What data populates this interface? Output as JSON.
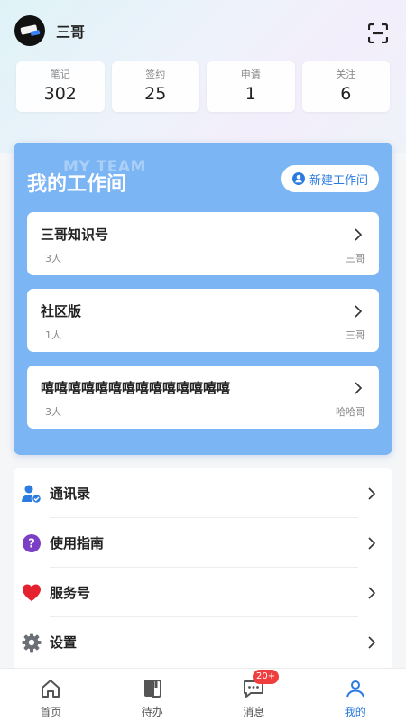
{
  "user": {
    "name": "三哥"
  },
  "stats": [
    {
      "label": "笔记",
      "value": "302"
    },
    {
      "label": "签约",
      "value": "25"
    },
    {
      "label": "申请",
      "value": "1"
    },
    {
      "label": "关注",
      "value": "6"
    }
  ],
  "team": {
    "bg_text": "MY TEAM",
    "title": "我的工作间",
    "new_button": "新建工作间",
    "workspaces": [
      {
        "name": "三哥知识号",
        "count": "3人",
        "owner": "三哥"
      },
      {
        "name": "社区版",
        "count": "1人",
        "owner": "三哥"
      },
      {
        "name": "嘻嘻嘻嘻嘻嘻嘻嘻嘻嘻嘻嘻嘻嘻",
        "count": "3人",
        "owner": "哈哈哥"
      }
    ]
  },
  "menu": [
    {
      "label": "通讯录",
      "icon": "contacts-icon",
      "color": "#2b7be0"
    },
    {
      "label": "使用指南",
      "icon": "help-icon",
      "color": "#7b3fc6"
    },
    {
      "label": "服务号",
      "icon": "heart-icon",
      "color": "#e5202f"
    },
    {
      "label": "设置",
      "icon": "gear-icon",
      "color": "#6b6f76"
    }
  ],
  "tabs": [
    {
      "label": "首页",
      "icon": "home-icon"
    },
    {
      "label": "待办",
      "icon": "book-icon"
    },
    {
      "label": "消息",
      "icon": "message-icon",
      "badge": "20+"
    },
    {
      "label": "我的",
      "icon": "user-icon",
      "active": true
    }
  ],
  "colors": {
    "accent": "#2b7be0",
    "team_card": "#7cb5f4",
    "badge": "#f03d3d"
  }
}
